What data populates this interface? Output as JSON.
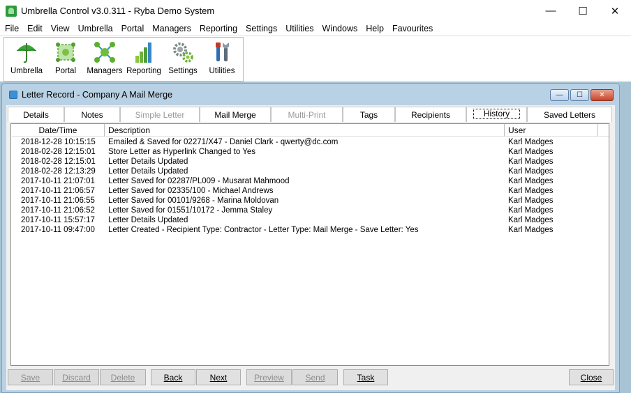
{
  "window": {
    "title": "Umbrella Control v3.0.311 - Ryba Demo System",
    "minimize_glyph": "—",
    "maximize_glyph": "☐",
    "close_glyph": "✕"
  },
  "menu": [
    "File",
    "Edit",
    "View",
    "Umbrella",
    "Portal",
    "Managers",
    "Reporting",
    "Settings",
    "Utilities",
    "Windows",
    "Help",
    "Favourites"
  ],
  "toolbar": [
    {
      "label": "Umbrella",
      "icon": "umbrella-icon"
    },
    {
      "label": "Portal",
      "icon": "portal-icon"
    },
    {
      "label": "Managers",
      "icon": "managers-icon"
    },
    {
      "label": "Reporting",
      "icon": "bar-chart-icon"
    },
    {
      "label": "Settings",
      "icon": "gears-icon"
    },
    {
      "label": "Utilities",
      "icon": "tools-icon"
    }
  ],
  "child": {
    "title": "Letter Record - Company A Mail Merge"
  },
  "tabs": [
    {
      "label": "Details",
      "state": "normal"
    },
    {
      "label": "Notes",
      "state": "normal"
    },
    {
      "label": "Simple Letter",
      "state": "disabled"
    },
    {
      "label": "Mail Merge",
      "state": "normal"
    },
    {
      "label": "Multi-Print",
      "state": "disabled"
    },
    {
      "label": "Tags",
      "state": "normal"
    },
    {
      "label": "Recipients",
      "state": "normal"
    },
    {
      "label": "History",
      "state": "active"
    },
    {
      "label": "Saved Letters",
      "state": "normal"
    }
  ],
  "history": {
    "columns": {
      "date": "Date/Time",
      "description": "Description",
      "user": "User"
    },
    "rows": [
      {
        "date": "2018-12-28 10:15:15",
        "description": "Emailed & Saved for 02271/X47 - Daniel Clark - qwerty@dc.com",
        "user": "Karl Madges"
      },
      {
        "date": "2018-02-28 12:15:01",
        "description": "Store Letter as Hyperlink Changed to Yes",
        "user": "Karl Madges"
      },
      {
        "date": "2018-02-28 12:15:01",
        "description": "Letter Details Updated",
        "user": "Karl Madges"
      },
      {
        "date": "2018-02-28 12:13:29",
        "description": "Letter Details Updated",
        "user": "Karl Madges"
      },
      {
        "date": "2017-10-11 21:07:01",
        "description": "Letter Saved for 02287/PL009 - Musarat Mahmood",
        "user": "Karl Madges"
      },
      {
        "date": "2017-10-11 21:06:57",
        "description": "Letter Saved for 02335/100 - Michael Andrews",
        "user": "Karl Madges"
      },
      {
        "date": "2017-10-11 21:06:55",
        "description": "Letter Saved for 00101/9268 - Marina Moldovan",
        "user": "Karl Madges"
      },
      {
        "date": "2017-10-11 21:06:52",
        "description": "Letter Saved for 01551/10172 - Jemma Staley",
        "user": "Karl Madges"
      },
      {
        "date": "2017-10-11 15:57:17",
        "description": "Letter Details Updated",
        "user": "Karl Madges"
      },
      {
        "date": "2017-10-11 09:47:00",
        "description": "Letter Created - Recipient Type: Contractor - Letter Type: Mail Merge - Save Letter: Yes",
        "user": "Karl Madges"
      }
    ]
  },
  "buttons": [
    {
      "label": "Save",
      "state": "disabled"
    },
    {
      "label": "Discard",
      "state": "disabled"
    },
    {
      "label": "Delete",
      "state": "disabled"
    },
    {
      "label": "Back",
      "state": "enabled"
    },
    {
      "label": "Next",
      "state": "enabled"
    },
    {
      "label": "Preview",
      "state": "disabled"
    },
    {
      "label": "Send",
      "state": "disabled"
    },
    {
      "label": "Task",
      "state": "enabled"
    },
    {
      "label": "Close",
      "state": "enabled"
    }
  ]
}
